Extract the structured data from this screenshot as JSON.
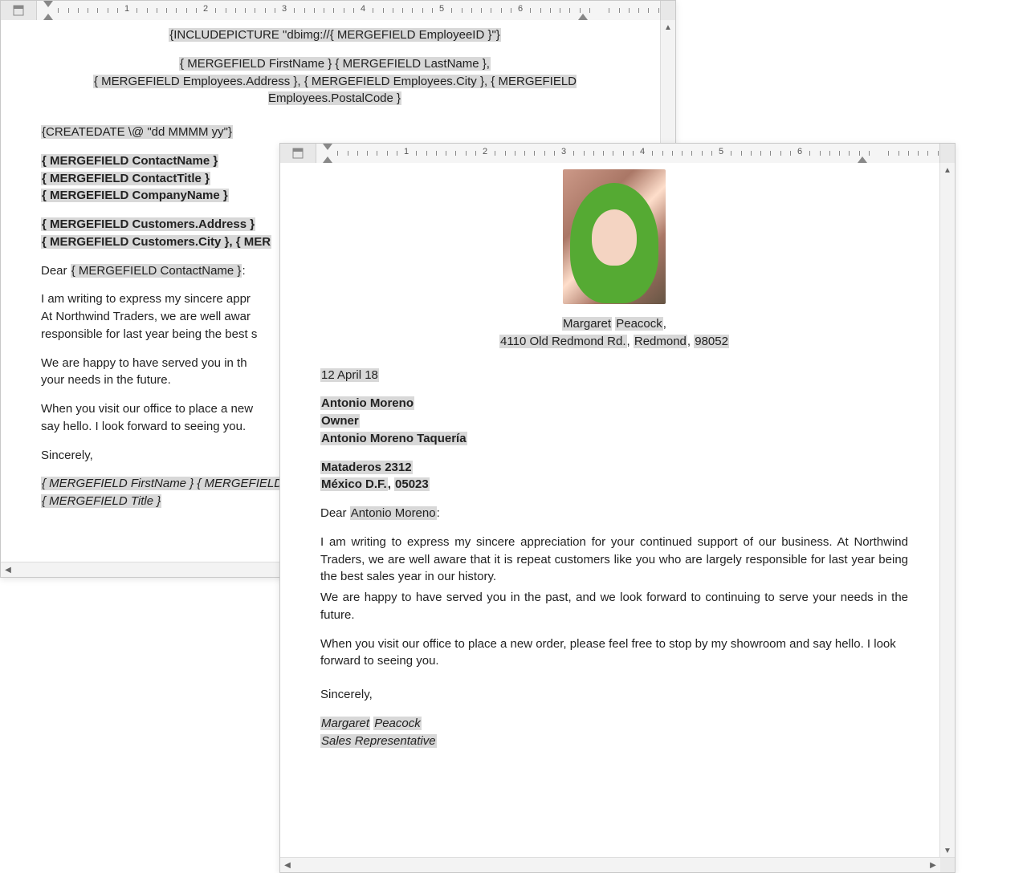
{
  "ruler": {
    "numbers": [
      "1",
      "2",
      "3",
      "4",
      "5",
      "6"
    ]
  },
  "template": {
    "includePicture": "{INCLUDEPICTURE \"dbimg://{ MERGEFIELD EmployeeID }\"}",
    "nameLine": "{ MERGEFIELD FirstName } { MERGEFIELD LastName },",
    "addressLine": "{ MERGEFIELD Employees.Address }, { MERGEFIELD Employees.City }, { MERGEFIELD Employees.PostalCode }",
    "createDate": "{CREATEDATE  \\@ \"dd MMMM yy\"}",
    "contactName": "{ MERGEFIELD ContactName }",
    "contactTitle": "{ MERGEFIELD ContactTitle }",
    "companyName": "{ MERGEFIELD CompanyName }",
    "customersAddress": "{ MERGEFIELD Customers.Address }",
    "customersCityPrefix": "{ MERGEFIELD Customers.City }, { MER",
    "dearPrefix": "Dear ",
    "dearField": "{ MERGEFIELD ContactName }",
    "dearSuffix": ":",
    "para1": "I am writing to express my sincere appr",
    "para2": "At Northwind Traders, we are well awar",
    "para3": "responsible for last year being the best s",
    "para4": "We are happy to have served you in th",
    "para5": "your needs in the future.",
    "para6": "When you visit our office to place a new",
    "para7": "say hello. I look forward to seeing you.",
    "sincerely": "Sincerely,",
    "sigLine1": "{ MERGEFIELD FirstName } { MERGEFIELD",
    "sigLine2": "{ MERGEFIELD Title }"
  },
  "merged": {
    "employeeFirst": "Margaret",
    "employeeLast": "Peacock",
    "empAddr": "4110 Old Redmond Rd.",
    "empCity": "Redmond",
    "empPostal": "98052",
    "date": "12 April 18",
    "contactName": "Antonio Moreno",
    "contactTitle": "Owner",
    "companyName": "Antonio Moreno Taquería",
    "custAddrStreet": "Mataderos  2312",
    "custCity": "México D.F.",
    "custPostal": "05023",
    "dearPrefix": "Dear ",
    "dearSuffix": ":",
    "body1": "I am writing to express my sincere appreciation for your continued support of our business. At Northwind Traders, we are well aware that it is repeat customers like you who are largely responsible for last year being the best sales year in our history.",
    "body2": "We are happy to have served you in the past, and we look forward to continuing to serve your needs in the future.",
    "body3": "When you visit our office to place a new order, please feel free to stop by my showroom and say hello. I look forward to seeing you.",
    "sincerely": "Sincerely,",
    "sigTitle": "Sales Representative"
  }
}
